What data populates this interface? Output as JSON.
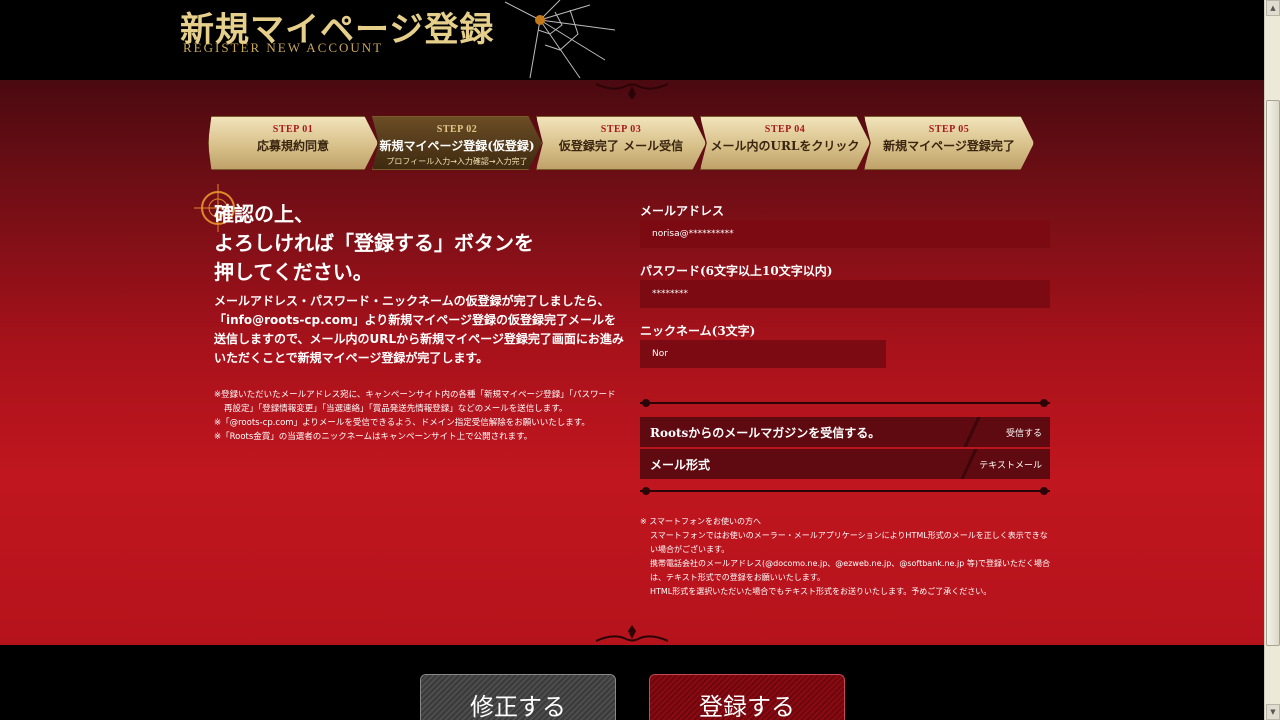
{
  "header": {
    "title": "新規マイページ登録",
    "subtitle": "REGISTER NEW ACCOUNT"
  },
  "steps": [
    {
      "num": "STEP 01",
      "label": "応募規約同意",
      "sub": ""
    },
    {
      "num": "STEP 02",
      "label": "新規マイページ登録(仮登録)",
      "sub": "プロフィール入力→入力確認→入力完了"
    },
    {
      "num": "STEP 03",
      "label": "仮登録完了 メール受信",
      "sub": ""
    },
    {
      "num": "STEP 04",
      "label": "メール内のURLをクリック",
      "sub": ""
    },
    {
      "num": "STEP 05",
      "label": "新規マイページ登録完了",
      "sub": ""
    }
  ],
  "active_step": 1,
  "left": {
    "headline_1": "確認の上、",
    "headline_2": "よろしければ「登録する」ボタンを",
    "headline_3": "押してください。",
    "body": "メールアドレス・パスワード・ニックネームの仮登録が完了しましたら、「info@roots-cp.com」より新規マイページ登録の仮登録完了メールを送信しますので、メール内のURLから新規マイページ登録完了画面にお進みいただくことで新規マイページ登録が完了します。",
    "note_1": "※登録いただいたメールアドレス宛に、キャンペーンサイト内の各種「新規マイページ登録」「パスワード再設定」「登録情報変更」「当選連絡」「賞品発送先情報登録」などのメールを送信します。",
    "note_2": "※「@roots-cp.com」よりメールを受信できるよう、ドメイン指定受信解除をお願いいたします。",
    "note_3": "※「Roots金賞」の当選者のニックネームはキャンペーンサイト上で公開されます。"
  },
  "form": {
    "email_label": "メールアドレス",
    "email_value": "norisa@**********",
    "password_label": "パスワード(6文字以上10文字以内)",
    "password_value": "********",
    "nickname_label": "ニックネーム(3文字)",
    "nickname_value": "Nor",
    "magazine_label": "Rootsからのメールマガジンを受信する。",
    "magazine_value": "受信する",
    "mail_format_label": "メール形式",
    "mail_format_value": "テキストメール"
  },
  "smartphone_notes": {
    "line_1": "※ スマートフォンをお使いの方へ",
    "line_2": "スマートフォンではお使いのメーラー・メールアプリケーションによりHTML形式のメールを正しく表示できない場合がございます。",
    "line_3": "携帯電話会社のメールアドレス(@docomo.ne.jp、@ezweb.ne.jp、@softbank.ne.jp 等)で登録いただく場合は、テキスト形式での登録をお願いいたします。",
    "line_4": "HTML形式を選択いただいた場合でもテキスト形式をお送りいたします。予めご了承ください。"
  },
  "buttons": {
    "fix": "修正する",
    "register": "登録する"
  },
  "colors": {
    "header_gold": "#e6cf8a",
    "main_red": "#c0161f",
    "input_bg": "#7c0a12"
  }
}
